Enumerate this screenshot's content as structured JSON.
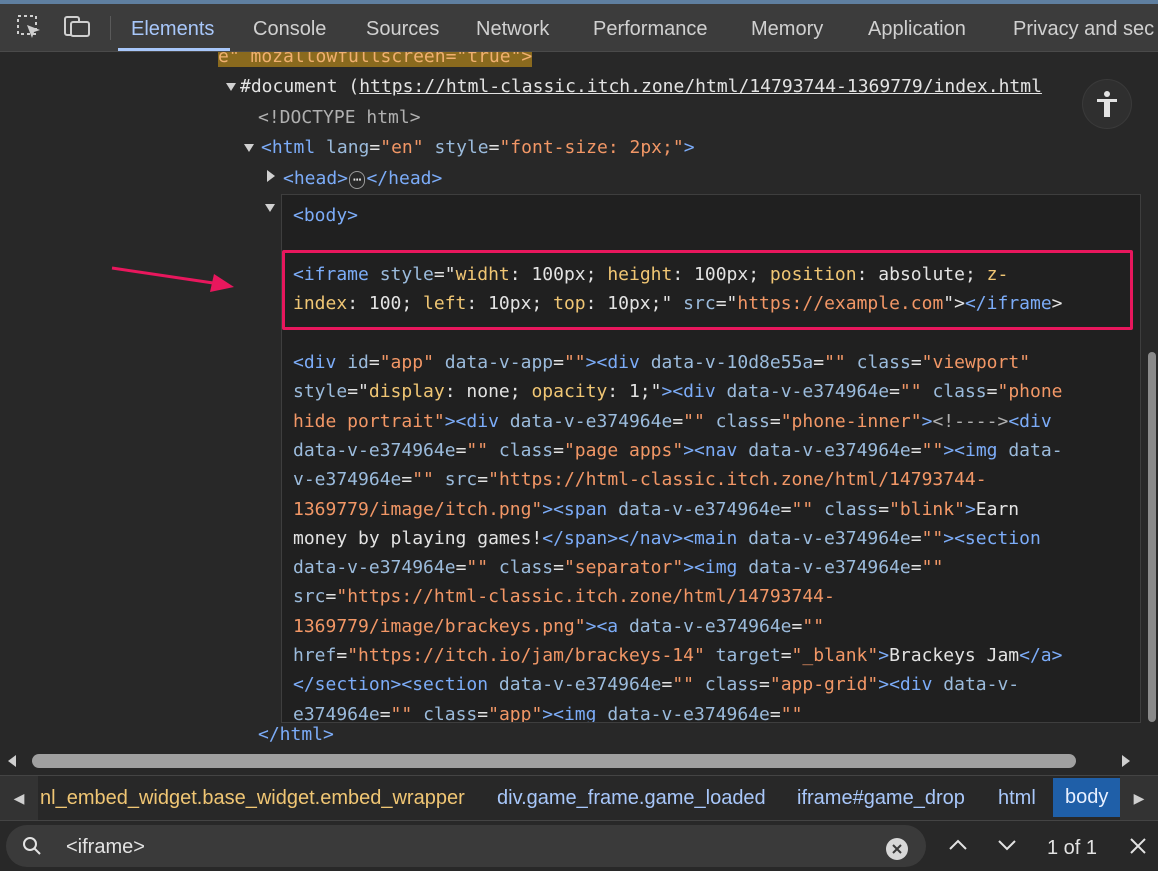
{
  "tabs": [
    {
      "label": "Elements",
      "active": true
    },
    {
      "label": "Console"
    },
    {
      "label": "Sources"
    },
    {
      "label": "Network"
    },
    {
      "label": "Performance"
    },
    {
      "label": "Memory"
    },
    {
      "label": "Application"
    },
    {
      "label": "Privacy and sec"
    }
  ],
  "dom": {
    "line0_attr": "e\" mozallowfullscreen=\"true\">",
    "doc_label": "#document (",
    "doc_url": "https://html-classic.itch.zone/html/14793744-1369779/index.html",
    "doctype": "<!DOCTYPE html>",
    "html_tag": "<html",
    "html_lang_name": "lang",
    "html_lang_val": "\"en\"",
    "html_style_name": "style",
    "html_style_val": "\"font-size: 2px;\"",
    "html_close_bracket": ">",
    "head_open": "<head>",
    "head_ellipsis": "⋯",
    "head_close": "</head>",
    "html_close": "</html>"
  },
  "popup": {
    "body_open": "<body>",
    "iframe_l1": [
      [
        "tag",
        "<iframe "
      ],
      [
        "attr",
        "style"
      ],
      [
        "plain",
        "=\""
      ],
      [
        "aname",
        "widht"
      ],
      [
        "plain",
        ": 100px; "
      ],
      [
        "aname",
        "height"
      ],
      [
        "plain",
        ": 100px; "
      ],
      [
        "aname",
        "position"
      ],
      [
        "plain",
        ": absolute; "
      ],
      [
        "aname",
        "z-"
      ]
    ],
    "iframe_l2": [
      [
        "aname",
        "index"
      ],
      [
        "plain",
        ": 100; "
      ],
      [
        "aname",
        "left"
      ],
      [
        "plain",
        ": 10px; "
      ],
      [
        "aname",
        "top"
      ],
      [
        "plain",
        ": 10px;"
      ],
      [
        "plain",
        "\" "
      ],
      [
        "attr",
        "src"
      ],
      [
        "plain",
        "=\""
      ],
      [
        "aval",
        "https://example.com"
      ],
      [
        "plain",
        "\">"
      ],
      [
        "tag",
        "</iframe"
      ],
      [
        "plain",
        ">"
      ]
    ],
    "div_lines": [
      [
        [
          "tag",
          "<div "
        ],
        [
          "attr",
          "id"
        ],
        [
          "plain",
          "="
        ],
        [
          "aval",
          "\"app\""
        ],
        [
          "attr",
          " data-v-app"
        ],
        [
          "plain",
          "="
        ],
        [
          "aval",
          "\"\""
        ],
        [
          "tag",
          "><div "
        ],
        [
          "attr",
          "data-v-10d8e55a"
        ],
        [
          "plain",
          "="
        ],
        [
          "aval",
          "\"\""
        ],
        [
          "attr",
          " class"
        ],
        [
          "plain",
          "="
        ],
        [
          "aval",
          "\"viewport\""
        ]
      ],
      [
        [
          "attr",
          "style"
        ],
        [
          "plain",
          "=\""
        ],
        [
          "aname",
          "display"
        ],
        [
          "plain",
          ": none; "
        ],
        [
          "aname",
          "opacity"
        ],
        [
          "plain",
          ": 1;\""
        ],
        [
          "tag",
          "><div "
        ],
        [
          "attr",
          "data-v-e374964e"
        ],
        [
          "plain",
          "="
        ],
        [
          "aval",
          "\"\""
        ],
        [
          "attr",
          " class"
        ],
        [
          "plain",
          "="
        ],
        [
          "aval",
          "\"phone"
        ]
      ],
      [
        [
          "aval",
          "hide portrait\""
        ],
        [
          "tag",
          "><div "
        ],
        [
          "attr",
          "data-v-e374964e"
        ],
        [
          "plain",
          "="
        ],
        [
          "aval",
          "\"\""
        ],
        [
          "attr",
          " class"
        ],
        [
          "plain",
          "="
        ],
        [
          "aval",
          "\"phone-inner\""
        ],
        [
          "tag",
          ">"
        ],
        [
          "grey",
          "<!---->"
        ],
        [
          "tag",
          "<div"
        ]
      ],
      [
        [
          "attr",
          "data-v-e374964e"
        ],
        [
          "plain",
          "="
        ],
        [
          "aval",
          "\"\""
        ],
        [
          "attr",
          " class"
        ],
        [
          "plain",
          "="
        ],
        [
          "aval",
          "\"page apps\""
        ],
        [
          "tag",
          "><nav "
        ],
        [
          "attr",
          "data-v-e374964e"
        ],
        [
          "plain",
          "="
        ],
        [
          "aval",
          "\"\""
        ],
        [
          "tag",
          "><img "
        ],
        [
          "attr",
          "data-"
        ]
      ],
      [
        [
          "attr",
          "v-e374964e"
        ],
        [
          "plain",
          "="
        ],
        [
          "aval",
          "\"\""
        ],
        [
          "attr",
          " src"
        ],
        [
          "plain",
          "="
        ],
        [
          "aval",
          "\"https://html-classic.itch.zone/html/14793744-"
        ]
      ],
      [
        [
          "aval",
          "1369779/image/itch.png\""
        ],
        [
          "tag",
          "><span "
        ],
        [
          "attr",
          "data-v-e374964e"
        ],
        [
          "plain",
          "="
        ],
        [
          "aval",
          "\"\""
        ],
        [
          "attr",
          " class"
        ],
        [
          "plain",
          "="
        ],
        [
          "aval",
          "\"blink\""
        ],
        [
          "tag",
          ">"
        ],
        [
          "plain",
          "Earn"
        ]
      ],
      [
        [
          "plain",
          "money by playing games!"
        ],
        [
          "tag",
          "</span></nav><main "
        ],
        [
          "attr",
          "data-v-e374964e"
        ],
        [
          "plain",
          "="
        ],
        [
          "aval",
          "\"\""
        ],
        [
          "tag",
          "><section"
        ]
      ],
      [
        [
          "attr",
          "data-v-e374964e"
        ],
        [
          "plain",
          "="
        ],
        [
          "aval",
          "\"\""
        ],
        [
          "attr",
          " class"
        ],
        [
          "plain",
          "="
        ],
        [
          "aval",
          "\"separator\""
        ],
        [
          "tag",
          "><img "
        ],
        [
          "attr",
          "data-v-e374964e"
        ],
        [
          "plain",
          "="
        ],
        [
          "aval",
          "\"\""
        ]
      ],
      [
        [
          "attr",
          "src"
        ],
        [
          "plain",
          "="
        ],
        [
          "aval",
          "\"https://html-classic.itch.zone/html/14793744-"
        ]
      ],
      [
        [
          "aval",
          "1369779/image/brackeys.png\""
        ],
        [
          "tag",
          "><a "
        ],
        [
          "attr",
          "data-v-e374964e"
        ],
        [
          "plain",
          "="
        ],
        [
          "aval",
          "\"\""
        ]
      ],
      [
        [
          "attr",
          "href"
        ],
        [
          "plain",
          "="
        ],
        [
          "aval",
          "\"https://itch.io/jam/brackeys-14\""
        ],
        [
          "attr",
          " target"
        ],
        [
          "plain",
          "="
        ],
        [
          "aval",
          "\"_blank\""
        ],
        [
          "tag",
          ">"
        ],
        [
          "plain",
          "Brackeys Jam"
        ],
        [
          "tag",
          "</a>"
        ]
      ],
      [
        [
          "tag",
          "</section><section "
        ],
        [
          "attr",
          "data-v-e374964e"
        ],
        [
          "plain",
          "="
        ],
        [
          "aval",
          "\"\""
        ],
        [
          "attr",
          " class"
        ],
        [
          "plain",
          "="
        ],
        [
          "aval",
          "\"app-grid\""
        ],
        [
          "tag",
          "><div "
        ],
        [
          "attr",
          "data-v-"
        ]
      ],
      [
        [
          "attr",
          "e374964e"
        ],
        [
          "plain",
          "="
        ],
        [
          "aval",
          "\"\""
        ],
        [
          "attr",
          " class"
        ],
        [
          "plain",
          "="
        ],
        [
          "aval",
          "\"app\""
        ],
        [
          "tag",
          "><img "
        ],
        [
          "attr",
          "data-v-e374964e"
        ],
        [
          "plain",
          "="
        ],
        [
          "aval",
          "\"\""
        ]
      ]
    ]
  },
  "breadcrumbs": [
    {
      "label": "nl_embed_widget.base_widget.embed_wrapper",
      "color": "#f0c674"
    },
    {
      "label": "div.game_frame.game_loaded"
    },
    {
      "label": "iframe#game_drop"
    },
    {
      "label": "html"
    },
    {
      "label": "body",
      "selected": true
    }
  ],
  "search": {
    "value": "<iframe>",
    "count": "1 of 1"
  },
  "colors": {
    "accent": "#a8c7fa",
    "highlight_box": "#e8175d",
    "arrow": "#e8175d"
  }
}
